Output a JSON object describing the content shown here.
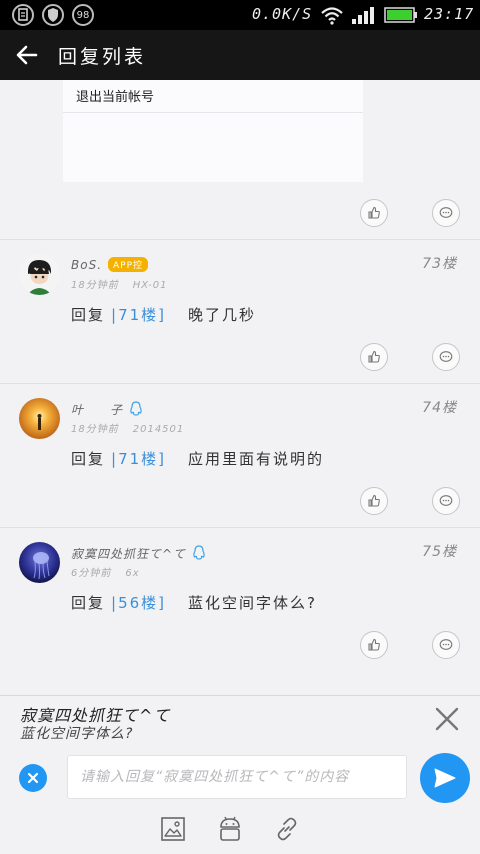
{
  "status_bar": {
    "net_speed": "0.0K/S",
    "time": "23:17",
    "badge_number": "98"
  },
  "appbar": {
    "title": "回复列表"
  },
  "top_card": {
    "quoted_line": "退出当前帐号"
  },
  "posts": [
    {
      "username": "BoS.",
      "badge": "APP控",
      "time": "18分钟前",
      "device": "HX-01",
      "floor": "73楼",
      "reply_label": "回复",
      "reply_ref": "|71楼]",
      "body": "晚了几秒"
    },
    {
      "username": "叶　　子",
      "time": "18分钟前",
      "device": "2014501",
      "floor": "74楼",
      "reply_label": "回复",
      "reply_ref": "|71楼]",
      "body": "应用里面有说明的"
    },
    {
      "username": "寂寞四处抓狂て^て",
      "time": "6分钟前",
      "device": "6x",
      "floor": "75楼",
      "reply_label": "回复",
      "reply_ref": "|56楼]",
      "body": "蓝化空间字体么?"
    }
  ],
  "reply_panel": {
    "reply_to_name": "寂寞四处抓狂て^て",
    "reply_to_text": "蓝化空间字体么?",
    "input_value": "",
    "input_placeholder": "请输入回复“寂寞四处抓狂て^て”的内容"
  },
  "colors": {
    "accent": "#2196f3",
    "link": "#3b8fd8",
    "badge": "#f5b100",
    "appbar": "#161616"
  }
}
